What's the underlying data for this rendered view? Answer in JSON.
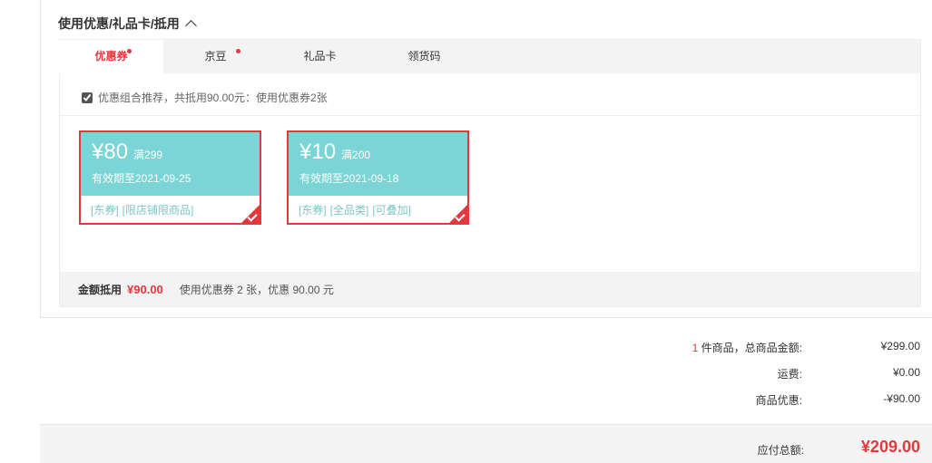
{
  "section": {
    "title": "使用优惠/礼品卡/抵用"
  },
  "tabs": [
    {
      "label": "优惠券"
    },
    {
      "label": "京豆"
    },
    {
      "label": "礼品卡"
    },
    {
      "label": "领货码"
    }
  ],
  "tip": "优惠组合推荐，共抵用90.00元：使用优惠券2张",
  "coupons": [
    {
      "amount": "¥80",
      "condition": "满299",
      "expiry": "有效期至2021-09-25",
      "tags": [
        "[东券]",
        "[限店铺限商品]"
      ]
    },
    {
      "amount": "¥10",
      "condition": "满200",
      "expiry": "有效期至2021-09-18",
      "tags": [
        "[东券]",
        "[全品类]",
        "[可叠加]"
      ]
    }
  ],
  "summary": {
    "label": "金额抵用",
    "amount": "¥90.00",
    "desc": "使用优惠券 2 张，优惠 90.00 元"
  },
  "totals": {
    "items_count": "1",
    "items_label": " 件商品，总商品金额:",
    "items_value": "¥299.00",
    "shipping_label": "运费:",
    "shipping_value": "¥0.00",
    "discount_label": "商品优惠:",
    "discount_value": "-¥90.00"
  },
  "footer": {
    "label": "应付总额:",
    "value": "¥209.00"
  },
  "colors": {
    "accent": "#e4393c",
    "coupon": "#7bd5d6"
  }
}
